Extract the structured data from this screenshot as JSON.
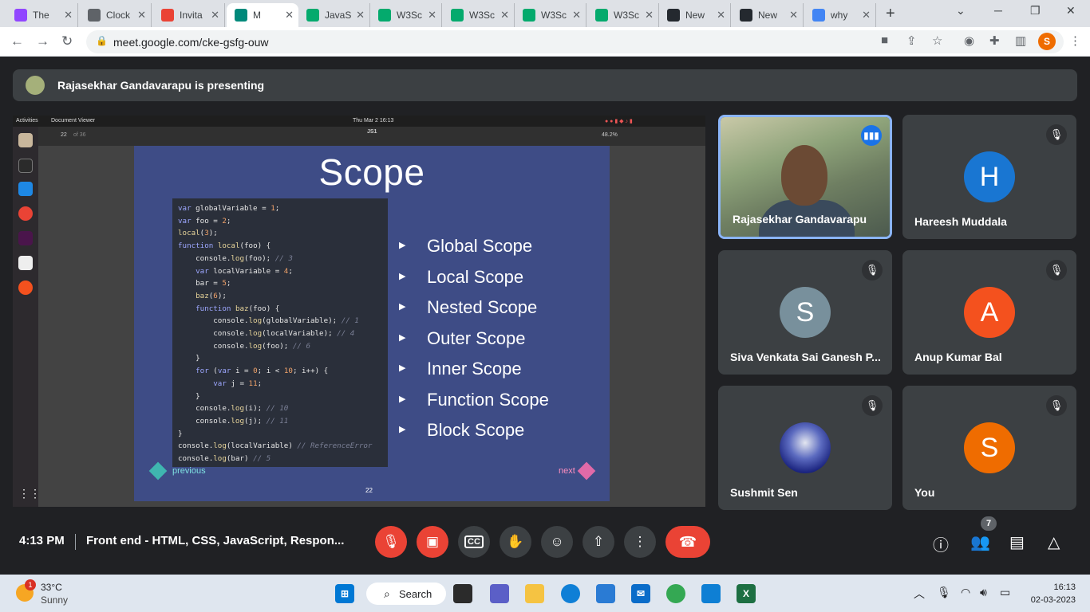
{
  "browser": {
    "tabs": [
      {
        "title": "The",
        "favicon": "twitch-icon",
        "color": "#9146ff"
      },
      {
        "title": "Clock",
        "favicon": "clock-icon",
        "color": "#5f6368"
      },
      {
        "title": "Invita",
        "favicon": "gmail-icon",
        "color": "#ea4335"
      },
      {
        "title": "M",
        "favicon": "meet-icon",
        "color": "#00897b"
      },
      {
        "title": "JavaS",
        "favicon": "w3schools-icon",
        "color": "#04aa6d"
      },
      {
        "title": "W3Sc",
        "favicon": "w3schools-icon",
        "color": "#04aa6d"
      },
      {
        "title": "W3Sc",
        "favicon": "w3schools-icon",
        "color": "#04aa6d"
      },
      {
        "title": "W3Sc",
        "favicon": "w3schools-icon",
        "color": "#04aa6d"
      },
      {
        "title": "W3Sc",
        "favicon": "w3schools-icon",
        "color": "#04aa6d"
      },
      {
        "title": "New",
        "favicon": "github-icon",
        "color": "#24292f"
      },
      {
        "title": "New",
        "favicon": "github-icon",
        "color": "#24292f"
      },
      {
        "title": "why",
        "favicon": "google-icon",
        "color": "#4285f4"
      }
    ],
    "url": "meet.google.com/cke-gsfg-ouw",
    "profile_initial": "S"
  },
  "meet": {
    "presenter_banner": "Rajasekhar Gandavarapu is presenting",
    "time": "4:13 PM",
    "meeting_title": "Front end - HTML, CSS, JavaScript, Respon...",
    "participant_count": "7",
    "participants": [
      {
        "name": "Rajasekhar Gandavarapu",
        "initial": "",
        "color": "",
        "speaking": true
      },
      {
        "name": "Hareesh Muddala",
        "initial": "H",
        "color": "#1976d2"
      },
      {
        "name": "Siva Venkata Sai Ganesh P...",
        "initial": "S",
        "color": "#78909c"
      },
      {
        "name": "Anup Kumar Bal",
        "initial": "A",
        "color": "#f4511e"
      },
      {
        "name": "Sushmit Sen",
        "initial": "",
        "color": "#1a237e"
      },
      {
        "name": "You",
        "initial": "S",
        "color": "#ef6c00"
      }
    ]
  },
  "shared_screen": {
    "topbar": {
      "activities": "Activities",
      "app": "Document Viewer",
      "datetime": "Thu Mar 2  16:13"
    },
    "viewer": {
      "page": "22",
      "of": "of 36",
      "doc_title": "JS1",
      "zoom": "48.2%"
    },
    "slide": {
      "title": "Scope",
      "bullets": [
        "Global Scope",
        "Local Scope",
        "Nested Scope",
        "Outer Scope",
        "Inner Scope",
        "Function Scope",
        "Block Scope"
      ],
      "prev": "previous",
      "next": "next",
      "page_number": "22"
    }
  },
  "taskbar": {
    "temperature": "33°C",
    "condition": "Sunny",
    "weather_badge": "1",
    "search_label": "Search",
    "time": "16:13",
    "date": "02-03-2023"
  }
}
